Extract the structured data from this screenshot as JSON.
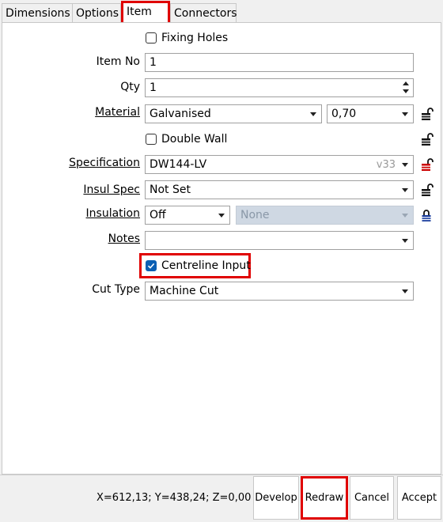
{
  "tabs": [
    "Dimensions",
    "Options",
    "Item",
    "Connectors"
  ],
  "fixing_holes": {
    "label": "Fixing Holes",
    "checked": false
  },
  "item_no": {
    "label": "Item No",
    "value": "1"
  },
  "qty": {
    "label": "Qty",
    "value": "1"
  },
  "material": {
    "label": "Material",
    "value": "Galvanised",
    "thickness": "0,70"
  },
  "double_wall": {
    "label": "Double Wall",
    "checked": false
  },
  "specification": {
    "label": "Specification",
    "value": "DW144-LV",
    "version": "v33"
  },
  "insul_spec": {
    "label": "Insul Spec",
    "value": "Not Set"
  },
  "insulation": {
    "label": "Insulation",
    "value": "Off",
    "secondary": "None"
  },
  "notes": {
    "label": "Notes",
    "value": ""
  },
  "centreline_input": {
    "label": "Centreline Input",
    "checked": true
  },
  "cut_type": {
    "label": "Cut Type",
    "value": "Machine Cut"
  },
  "status": {
    "coords": "X=612,13; Y=438,24; Z=0,00"
  },
  "buttons": {
    "develop": "Develop",
    "redraw": "Redraw",
    "cancel": "Cancel",
    "accept": "Accept"
  },
  "colors": {
    "highlight": "#e00000",
    "checkbox_on": "#0a5fb4",
    "lock_open": "#111111",
    "lock_red": "#cc0000",
    "lock_blue": "#1a3d9e"
  }
}
